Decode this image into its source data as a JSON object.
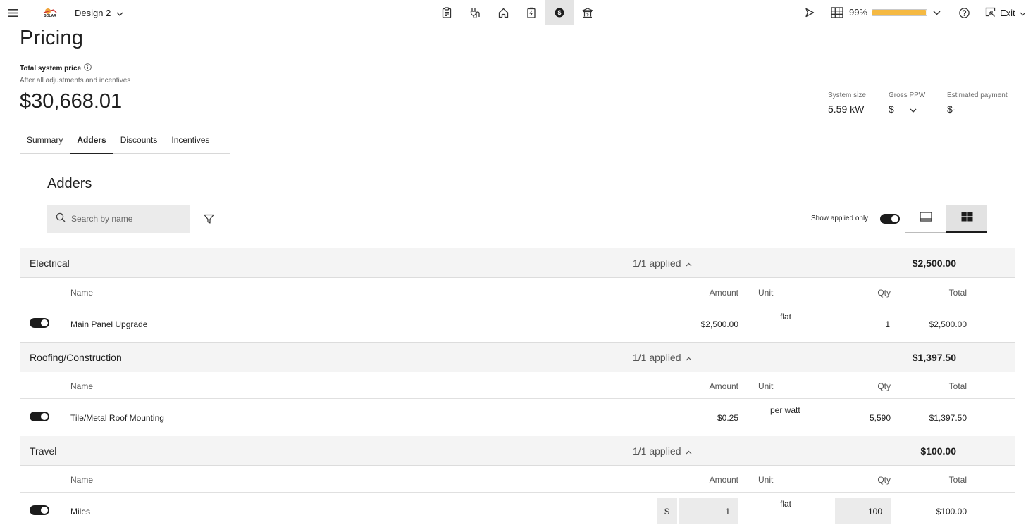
{
  "topbar": {
    "design_name": "Design 2",
    "logo_text": "SOLAR",
    "percent": "99%",
    "progress": 0.99,
    "exit_label": "Exit",
    "nav_icons": [
      "clipboard-icon",
      "plug-icon",
      "house-icon",
      "battery-icon",
      "dollar-icon",
      "bank-icon"
    ],
    "active_nav": "dollar-icon"
  },
  "page": {
    "title": "Pricing",
    "total_label": "Total system price",
    "total_sub": "After all adjustments and incentives",
    "total_price": "$30,668.01",
    "stats": {
      "system_size_label": "System size",
      "system_size_value": "5.59 kW",
      "gross_ppw_label": "Gross PPW",
      "gross_ppw_value": "$—",
      "est_payment_label": "Estimated payment",
      "est_payment_value": "$-"
    }
  },
  "tabs": [
    "Summary",
    "Adders",
    "Discounts",
    "Incentives"
  ],
  "active_tab": "Adders",
  "adders": {
    "title": "Adders",
    "search_placeholder": "Search by name",
    "show_applied_label": "Show applied only",
    "show_applied_on": true
  },
  "columns": {
    "name": "Name",
    "amount": "Amount",
    "unit": "Unit",
    "qty": "Qty",
    "total": "Total"
  },
  "groups": [
    {
      "name": "Electrical",
      "applied": "1/1 applied",
      "total": "$2,500.00",
      "row": {
        "enabled": true,
        "name": "Main Panel Upgrade",
        "amount": "$2,500.00",
        "unit": "flat",
        "qty": "1",
        "total": "$2,500.00"
      }
    },
    {
      "name": "Roofing/Construction",
      "applied": "1/1 applied",
      "total": "$1,397.50",
      "row": {
        "enabled": true,
        "name": "Tile/Metal Roof Mounting",
        "amount": "$0.25",
        "unit": "per watt",
        "qty": "5,590",
        "total": "$1,397.50"
      }
    },
    {
      "name": "Travel",
      "applied": "1/1 applied",
      "total": "$100.00",
      "row": {
        "enabled": true,
        "name": "Miles",
        "currency": "$",
        "amount": "1",
        "unit": "flat",
        "qty": "100",
        "total": "$100.00"
      }
    }
  ]
}
